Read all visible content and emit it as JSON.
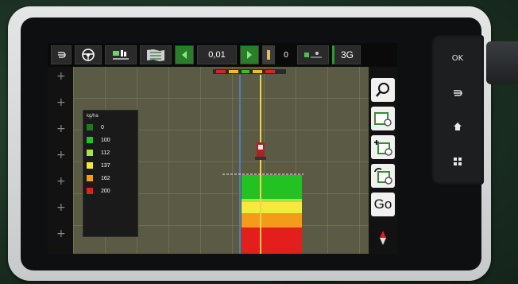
{
  "toolbar": {
    "zoom_value": "0,01",
    "sections_count": "0",
    "network_label": "3G"
  },
  "hardware_buttons": {
    "ok_label": "OK"
  },
  "map_controls": {
    "go_label": "Go"
  },
  "legend": {
    "unit": "kg/ha",
    "items": [
      {
        "value": "0",
        "color": "#1f7a1f"
      },
      {
        "value": "100",
        "color": "#22c322"
      },
      {
        "value": "112",
        "color": "#a6e83a"
      },
      {
        "value": "137",
        "color": "#f3ea3b"
      },
      {
        "value": "162",
        "color": "#f39c1a"
      },
      {
        "value": "200",
        "color": "#e41d1d"
      }
    ]
  },
  "colors": {
    "accent_green": "#2b7d2b",
    "guidance_line": "#f3d44a"
  }
}
